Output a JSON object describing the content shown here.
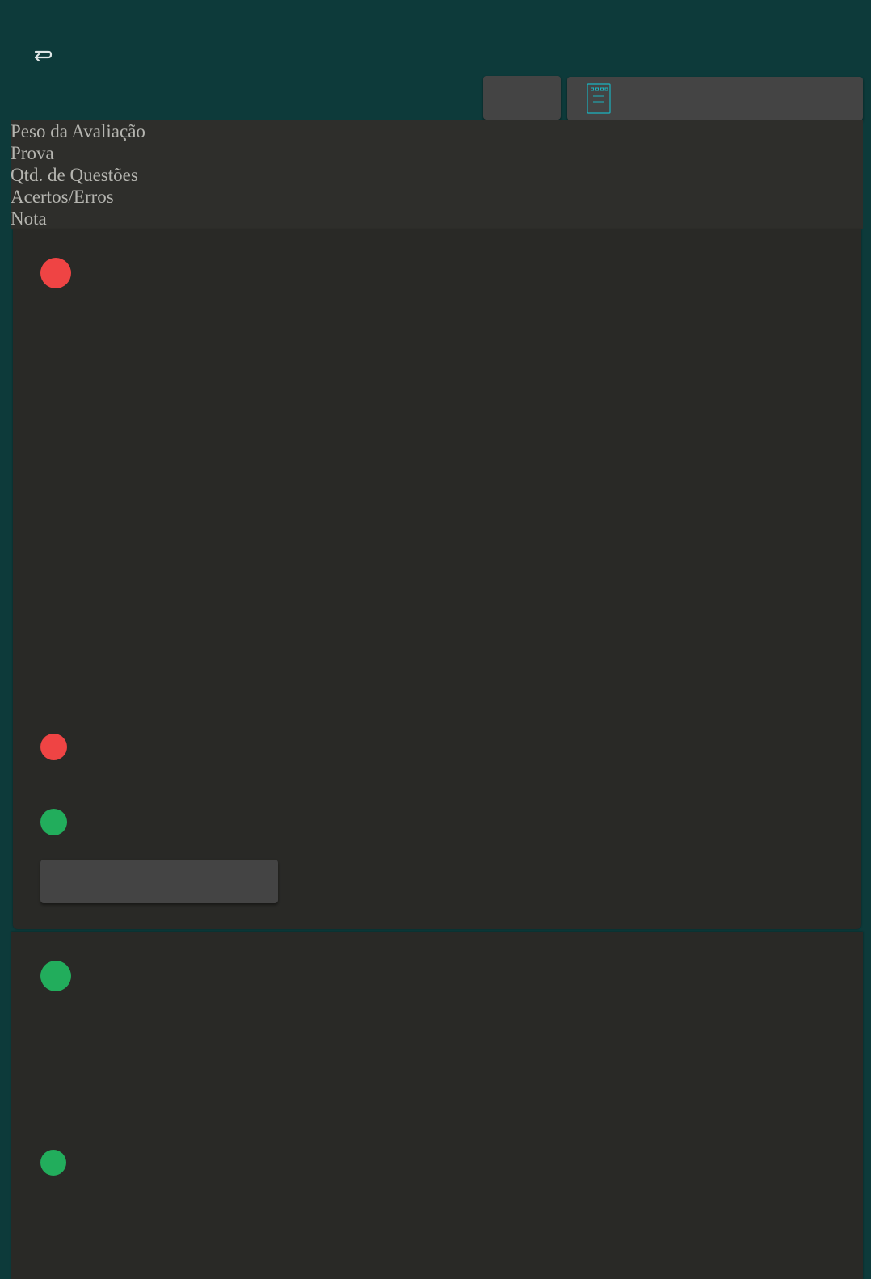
{
  "colors": {
    "background": "#0d3a3a",
    "panel": "#2e2e2b",
    "card": "#292926",
    "button": "#444444",
    "accent": "#1ab3c0",
    "status_wrong": "#ef4444",
    "status_correct": "#22ad5c"
  },
  "toolbar": {
    "back_icon": "return-arrow-icon",
    "report_icon": "document-icon"
  },
  "header": {
    "rows": [
      "Peso da Avaliação",
      "Prova",
      "Qtd. de Questões",
      "Acertos/Erros",
      "Nota"
    ]
  },
  "cards": [
    {
      "markers": [
        "wrong",
        "wrong",
        "correct"
      ]
    },
    {
      "markers": [
        "correct",
        "correct"
      ]
    }
  ]
}
